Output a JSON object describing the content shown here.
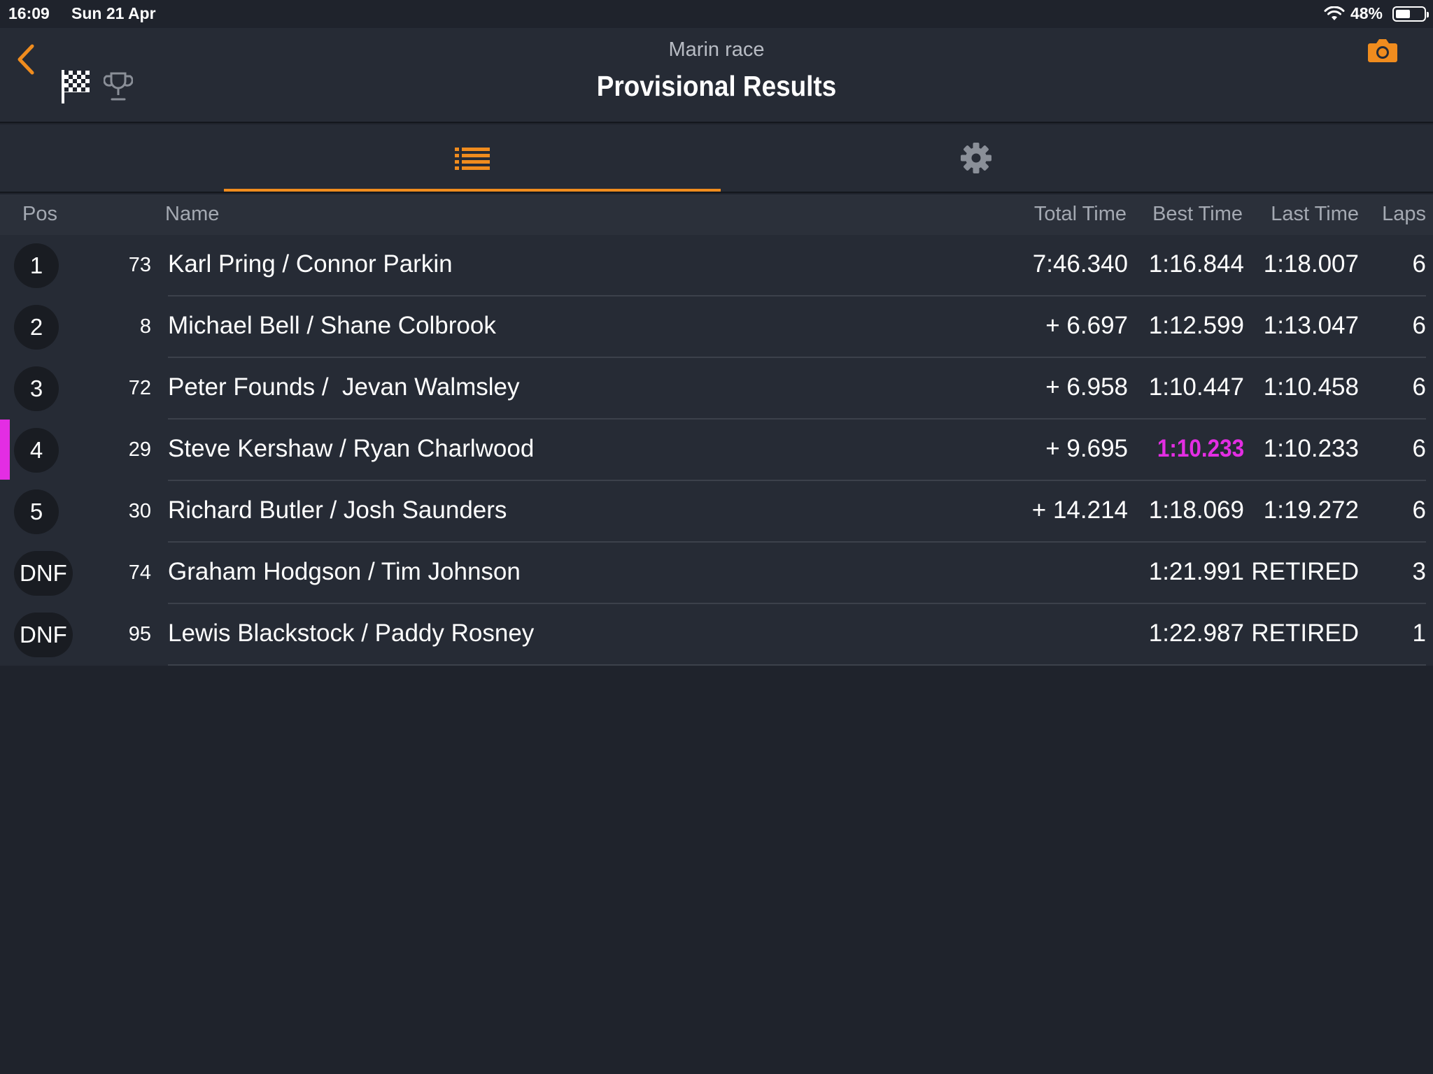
{
  "status": {
    "time": "16:09",
    "date": "Sun 21 Apr",
    "battery": "48%"
  },
  "header": {
    "subtitle": "Marin race",
    "title": "Provisional Results"
  },
  "colors": {
    "accent": "#f08c1e",
    "fastest_lap": "#e32de3",
    "background": "#1f232c",
    "row_bg": "#262b35"
  },
  "icons": {
    "back": "chevron-left-icon",
    "flag": "checkered-flag-icon",
    "trophy": "trophy-icon",
    "camera": "camera-icon",
    "results_tab": "list-icon",
    "settings_tab": "gear-icon"
  },
  "table": {
    "headers": {
      "pos": "Pos",
      "name": "Name",
      "total": "Total Time",
      "best": "Best Time",
      "last": "Last Time",
      "laps": "Laps"
    },
    "rows": [
      {
        "pos": "1",
        "num": "73",
        "name": "Karl Pring / Connor Parkin",
        "total": "7:46.340",
        "best": "1:16.844",
        "last": "1:18.007",
        "laps": "6"
      },
      {
        "pos": "2",
        "num": "8",
        "name": "Michael Bell / Shane Colbrook",
        "total": "+ 6.697",
        "best": "1:12.599",
        "last": "1:13.047",
        "laps": "6"
      },
      {
        "pos": "3",
        "num": "72",
        "name": "Peter Founds /  Jevan Walmsley",
        "total": "+ 6.958",
        "best": "1:10.447",
        "last": "1:10.458",
        "laps": "6"
      },
      {
        "pos": "4",
        "num": "29",
        "name": "Steve Kershaw / Ryan Charlwood",
        "total": "+ 9.695",
        "best": "1:10.233",
        "last": "1:10.233",
        "laps": "6"
      },
      {
        "pos": "5",
        "num": "30",
        "name": "Richard Butler / Josh Saunders",
        "total": "+ 14.214",
        "best": "1:18.069",
        "last": "1:19.272",
        "laps": "6"
      },
      {
        "pos": "DNF",
        "num": "74",
        "name": "Graham Hodgson / Tim Johnson",
        "total": "",
        "best": "1:21.991",
        "last": "RETIRED",
        "laps": "3"
      },
      {
        "pos": "DNF",
        "num": "95",
        "name": "Lewis Blackstock / Paddy Rosney",
        "total": "",
        "best": "1:22.987",
        "last": "RETIRED",
        "laps": "1"
      }
    ]
  }
}
